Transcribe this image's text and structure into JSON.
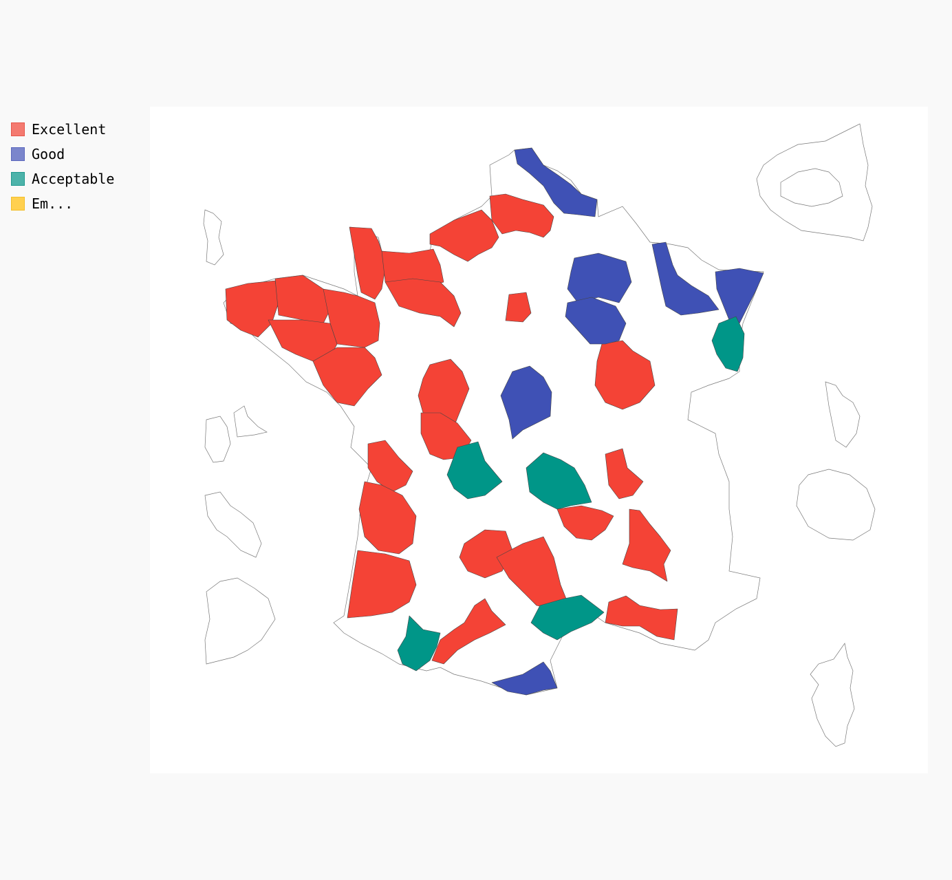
{
  "legend": {
    "items": [
      {
        "label": "Excellent",
        "color": "#f44336",
        "swatch_color": "#f47a70"
      },
      {
        "label": "Good",
        "color": "#3f51b5",
        "swatch_color": "#7b86cc"
      },
      {
        "label": "Acceptable",
        "color": "#009688",
        "swatch_color": "#4db3aa"
      },
      {
        "label": "Em...",
        "color": "#ffc107",
        "swatch_color": "#ffd04f"
      }
    ]
  },
  "map": {
    "region": "France departments",
    "unassigned_fill": "#ffffff",
    "departments": [
      {
        "category": "Excellent"
      },
      {
        "category": "Excellent"
      },
      {
        "category": "Excellent"
      },
      {
        "category": "Excellent"
      },
      {
        "category": "Excellent"
      },
      {
        "category": "Excellent"
      },
      {
        "category": "Excellent"
      },
      {
        "category": "Excellent"
      },
      {
        "category": "Excellent"
      },
      {
        "category": "Excellent"
      },
      {
        "category": "Excellent"
      },
      {
        "category": "Excellent"
      },
      {
        "category": "Excellent"
      },
      {
        "category": "Excellent"
      },
      {
        "category": "Excellent"
      },
      {
        "category": "Excellent"
      },
      {
        "category": "Excellent"
      },
      {
        "category": "Excellent"
      },
      {
        "category": "Excellent"
      },
      {
        "category": "Excellent"
      },
      {
        "category": "Good"
      },
      {
        "category": "Good"
      },
      {
        "category": "Good"
      },
      {
        "category": "Good"
      },
      {
        "category": "Good"
      },
      {
        "category": "Good"
      },
      {
        "category": "Good"
      },
      {
        "category": "Acceptable"
      },
      {
        "category": "Acceptable"
      },
      {
        "category": "Acceptable"
      },
      {
        "category": "Acceptable"
      },
      {
        "category": "Acceptable"
      }
    ]
  }
}
